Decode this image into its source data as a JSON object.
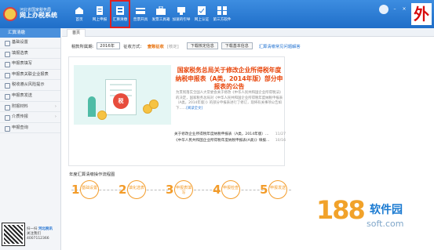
{
  "logo": {
    "sub": "河北省国家税务局",
    "main": "网上办税系统"
  },
  "nav": [
    {
      "label": "首页",
      "icon": "home-icon"
    },
    {
      "label": "网上申报",
      "icon": "declare-icon"
    },
    {
      "label": "汇算清缴",
      "icon": "settlement-icon",
      "active": true
    },
    {
      "label": "普票开具",
      "icon": "invoice-icon"
    },
    {
      "label": "发票工具箱",
      "icon": "toolbox-icon"
    },
    {
      "label": "加速的引导",
      "icon": "guide-icon"
    },
    {
      "label": "网上认证",
      "icon": "certify-icon"
    },
    {
      "label": "第三方软件",
      "icon": "thirdparty-icon"
    }
  ],
  "topright": {
    "wai": "外"
  },
  "sidebar": {
    "header": "汇算清缴",
    "items": [
      {
        "label": "基础设置"
      },
      {
        "label": "填报选表"
      },
      {
        "label": "申报表填写"
      },
      {
        "label": "申报表关联企业报表"
      },
      {
        "label": "税收遵从风险提示"
      },
      {
        "label": "申报表发送"
      },
      {
        "label": "附报材料",
        "arrow": "›"
      },
      {
        "label": "介质传报",
        "arrow": "›"
      },
      {
        "label": "申报查询"
      }
    ],
    "qr": {
      "line1": "扫一扫",
      "brand": "河北税讯",
      "line2": "关注我们",
      "phone": "4007112366"
    }
  },
  "tab": {
    "label": "首页"
  },
  "filter": {
    "period_label": "税款所属期:",
    "period_value": "2016年",
    "method_label": "征收方式：",
    "method_value": "查账征收",
    "method_note": "[核定]",
    "btn1": "下载核定信息",
    "btn2": "下载基本信息",
    "help_link": "汇算清缴常见问题解答"
  },
  "banner": {
    "seal": "税",
    "title": "国家税务总局关于修改企业所得税年度纳税申报表（A类，2014年版）部分申报表的公告",
    "body": "为贯彻落实全国人大常委会关于修改《中华人民共和国企业所得税法》的决定，国家税务总局对《中华人民共和国企业所得税年度纳税申报表（A类，2014年版）》的部分申报表进行了修订，现将有关事项公告如下……",
    "more": "[阅读全文]",
    "list": [
      {
        "text": "关于修改企业所得税年度纳税申报表（A类，2014年版）…",
        "date": "11/27"
      },
      {
        "text": "《中华人民共和国企业所得税年度纳税申报表(A类)》填报…",
        "date": "10/16"
      }
    ]
  },
  "steps_title": "年度汇算清缴操作流程图",
  "steps": [
    {
      "num": "1",
      "label": "基础设置"
    },
    {
      "num": "2",
      "label": "填化选表"
    },
    {
      "num": "3",
      "label": "申报表填写"
    },
    {
      "num": "4",
      "label": "申报检查"
    },
    {
      "num": "5",
      "label": "申报发送"
    }
  ],
  "watermark": {
    "num": "188",
    "name": "软件园",
    "url": "soft.com"
  },
  "colors": {
    "topbar": "#2a7bd4",
    "accent": "#e8450a",
    "step": "#f39c2a",
    "active_border": "#e02020"
  }
}
